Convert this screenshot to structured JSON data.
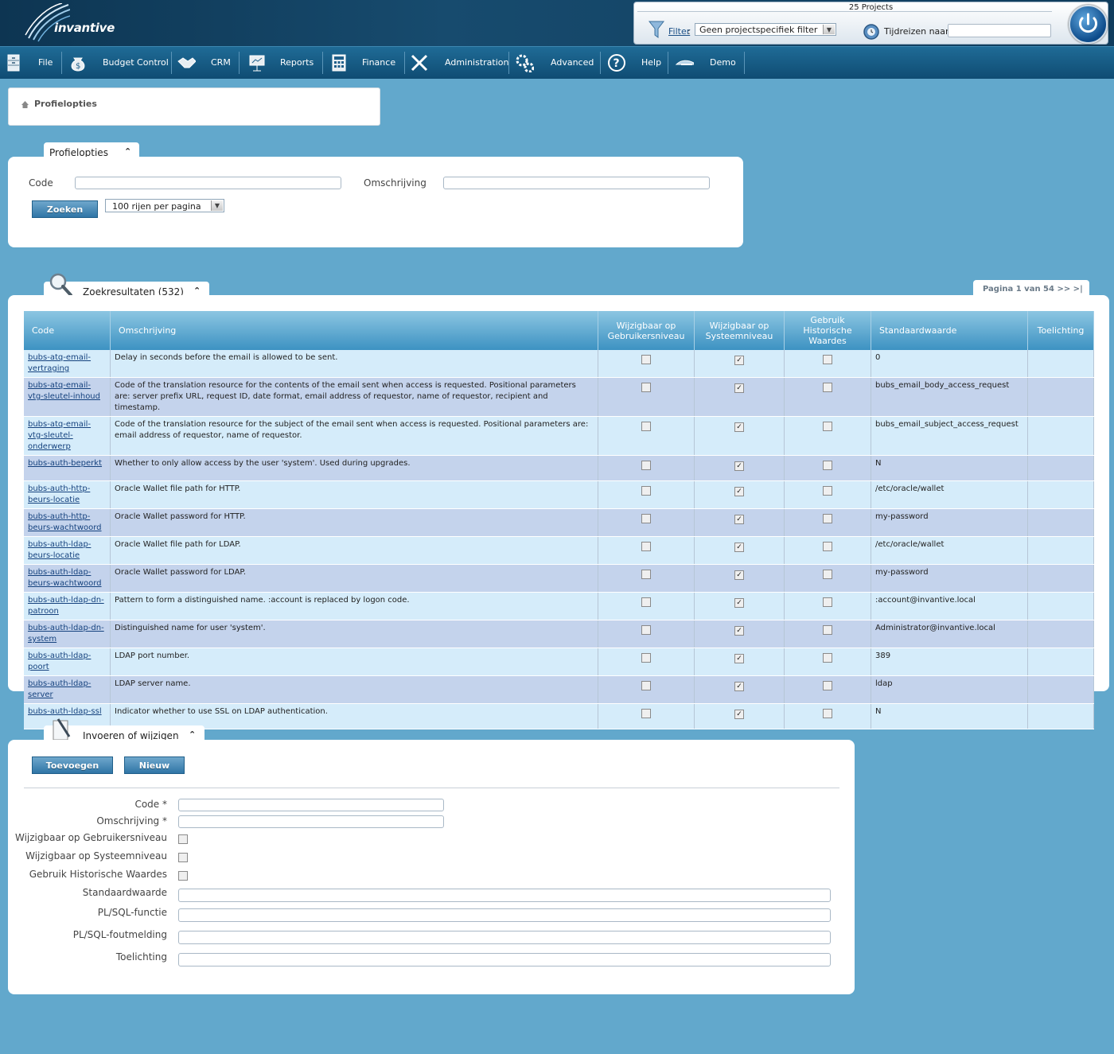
{
  "header": {
    "brand": "invantive",
    "project_count": "25 Projects",
    "filter_label": "Filter",
    "filter_colon": ":",
    "filter_value": "Geen projectspecifiek filter",
    "time_travel_label": "Tijdreizen naar:",
    "time_travel_value": ""
  },
  "menu": [
    {
      "label": "File",
      "icon": "cabinet-icon"
    },
    {
      "label": "Budget Control",
      "icon": "money-bag-icon"
    },
    {
      "label": "CRM",
      "icon": "handshake-icon"
    },
    {
      "label": "Reports",
      "icon": "presentation-icon"
    },
    {
      "label": "Finance",
      "icon": "calculator-icon"
    },
    {
      "label": "Administration",
      "icon": "tools-icon"
    },
    {
      "label": "Advanced",
      "icon": "gears-icon"
    },
    {
      "label": "Help",
      "icon": "question-icon"
    },
    {
      "label": "Demo",
      "icon": "plane-icon"
    }
  ],
  "breadcrumb": {
    "label": "Profielopties"
  },
  "search": {
    "tab_title": "Profielopties",
    "code_label": "Code",
    "code_value": "",
    "description_label": "Omschrijving",
    "description_value": "",
    "search_button": "Zoeken",
    "rows_per_page": "100 rijen per pagina"
  },
  "results": {
    "tab_title": "Zoekresultaten (532)",
    "pager": "Pagina 1 van 54  >>  >|",
    "columns": [
      "Code",
      "Omschrijving",
      "Wijzigbaar op Gebruikersniveau",
      "Wijzigbaar op Systeemniveau",
      "Gebruik Historische Waardes",
      "Standaardwaarde",
      "Toelichting"
    ],
    "rows": [
      {
        "code": "bubs-atq-email-vertraging",
        "description": "Delay in seconds before the email is allowed to be sent.",
        "user": false,
        "system": true,
        "history": false,
        "default": "0",
        "note": ""
      },
      {
        "code": "bubs-atq-email-vtg-sleutel-inhoud",
        "description": "Code of the translation resource for the contents of the email sent when access is requested. Positional parameters are: server prefix URL, request ID, date format, email address of requestor, name of requestor, recipient and timestamp.",
        "user": false,
        "system": true,
        "history": false,
        "default": "bubs_email_body_access_request",
        "note": ""
      },
      {
        "code": "bubs-atq-email-vtg-sleutel-onderwerp",
        "description": "Code of the translation resource for the subject of the email sent when access is requested. Positional parameters are: email address of requestor, name of requestor.",
        "user": false,
        "system": true,
        "history": false,
        "default": "bubs_email_subject_access_request",
        "note": ""
      },
      {
        "code": "bubs-auth-beperkt",
        "description": "Whether to only allow access by the user 'system'. Used during upgrades.",
        "user": false,
        "system": true,
        "history": false,
        "default": "N",
        "note": ""
      },
      {
        "code": "bubs-auth-http-beurs-locatie",
        "description": "Oracle Wallet file path for HTTP.",
        "user": false,
        "system": true,
        "history": false,
        "default": "/etc/oracle/wallet",
        "note": ""
      },
      {
        "code": "bubs-auth-http-beurs-wachtwoord",
        "description": "Oracle Wallet password for HTTP.",
        "user": false,
        "system": true,
        "history": false,
        "default": "my-password",
        "note": ""
      },
      {
        "code": "bubs-auth-ldap-beurs-locatie",
        "description": "Oracle Wallet file path for LDAP.",
        "user": false,
        "system": true,
        "history": false,
        "default": "/etc/oracle/wallet",
        "note": ""
      },
      {
        "code": "bubs-auth-ldap-beurs-wachtwoord",
        "description": "Oracle Wallet password for LDAP.",
        "user": false,
        "system": true,
        "history": false,
        "default": "my-password",
        "note": ""
      },
      {
        "code": "bubs-auth-ldap-dn-patroon",
        "description": "Pattern to form a distinguished name. :account is replaced by logon code.",
        "user": false,
        "system": true,
        "history": false,
        "default": ":account@invantive.local",
        "note": ""
      },
      {
        "code": "bubs-auth-ldap-dn-system",
        "description": "Distinguished name for user 'system'.",
        "user": false,
        "system": true,
        "history": false,
        "default": "Administrator@invantive.local",
        "note": ""
      },
      {
        "code": "bubs-auth-ldap-poort",
        "description": "LDAP port number.",
        "user": false,
        "system": true,
        "history": false,
        "default": "389",
        "note": ""
      },
      {
        "code": "bubs-auth-ldap-server",
        "description": "LDAP server name.",
        "user": false,
        "system": true,
        "history": false,
        "default": "ldap",
        "note": ""
      },
      {
        "code": "bubs-auth-ldap-ssl",
        "description": "Indicator whether to use SSL on LDAP authentication.",
        "user": false,
        "system": true,
        "history": false,
        "default": "N",
        "note": ""
      }
    ]
  },
  "edit": {
    "tab_title": "Invoeren of wijzigen",
    "add_button": "Toevoegen",
    "new_button": "Nieuw",
    "fields": {
      "code": "Code *",
      "description": "Omschrijving *",
      "user_level": "Wijzigbaar op Gebruikersniveau",
      "system_level": "Wijzigbaar op Systeemniveau",
      "history": "Gebruik Historische Waardes",
      "default": "Standaardwaarde",
      "plsql_function": "PL/SQL-functie",
      "plsql_error": "PL/SQL-foutmelding",
      "note": "Toelichting"
    }
  }
}
